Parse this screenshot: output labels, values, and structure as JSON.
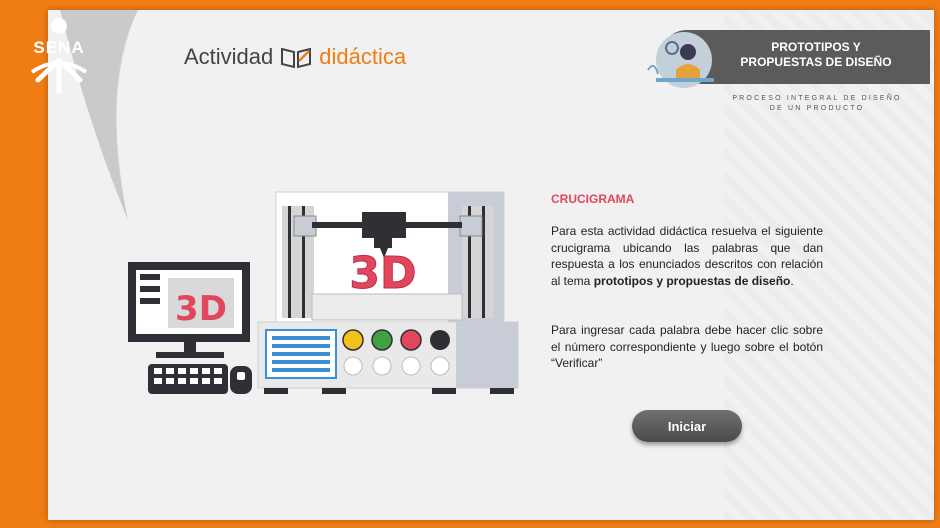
{
  "brand": {
    "logo_text": "SENA",
    "activity_word": "Actividad",
    "didactic_word": "didáctica"
  },
  "badge": {
    "title_line1": "PROTOTIPOS Y",
    "title_line2": "PROPUESTAS DE DISEÑO",
    "subtitle_line1": "PROCESO INTEGRAL DE DISEÑO",
    "subtitle_line2": "DE UN PRODUCTO"
  },
  "illustration": {
    "monitor_label": "3D",
    "printer_label": "3D"
  },
  "content": {
    "title": "CRUCIGRAMA",
    "desc1_start": "Para esta actividad didáctica resuelva el siguiente crucigrama ubicando las palabras que dan respuesta a los enunciados descritos con relación al tema ",
    "desc1_bold": "prototipos y propuestas de diseño",
    "desc1_end": ".",
    "desc2": "Para ingresar cada palabra debe hacer clic sobre el número correspondiente y luego sobre el botón “Verificar”"
  },
  "buttons": {
    "start_label": "Iniciar"
  },
  "colors": {
    "accent": "#f07c14",
    "title_red": "#e2465d",
    "badge_gray": "#5b5b5b"
  }
}
